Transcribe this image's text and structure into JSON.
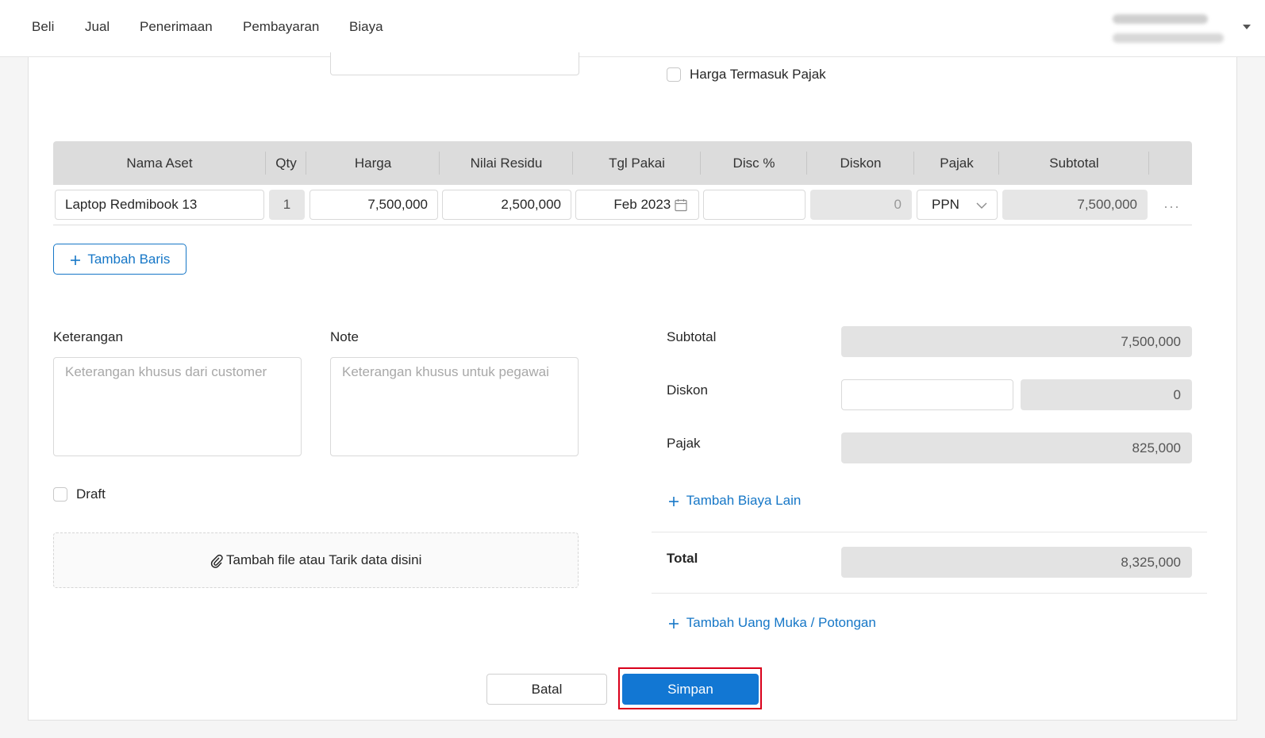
{
  "nav": {
    "items": [
      "Beli",
      "Jual",
      "Penerimaan",
      "Pembayaran",
      "Biaya"
    ]
  },
  "options": {
    "tax_included_label": "Harga Termasuk Pajak"
  },
  "table": {
    "headers": [
      "Nama Aset",
      "Qty",
      "Harga",
      "Nilai Residu",
      "Tgl Pakai",
      "Disc %",
      "Diskon",
      "Pajak",
      "Subtotal"
    ],
    "row": {
      "name": "Laptop Redmibook 13",
      "qty": "1",
      "price": "7,500,000",
      "residual": "2,500,000",
      "date": "Feb 2023",
      "disc_pct": "",
      "discount": "0",
      "tax": "PPN",
      "subtotal": "7,500,000",
      "more": "···"
    },
    "add_row_label": "Tambah Baris"
  },
  "notes": {
    "keterangan_label": "Keterangan",
    "keterangan_placeholder": "Keterangan khusus dari customer",
    "note_label": "Note",
    "note_placeholder": "Keterangan khusus untuk pegawai",
    "draft_label": "Draft",
    "attach_label": "Tambah file atau Tarik data disini"
  },
  "summary": {
    "subtotal_label": "Subtotal",
    "subtotal_value": "7,500,000",
    "diskon_label": "Diskon",
    "diskon_value": "0",
    "pajak_label": "Pajak",
    "pajak_value": "825,000",
    "add_cost_label": "Tambah Biaya Lain",
    "total_label": "Total",
    "total_value": "8,325,000",
    "add_down_payment_label": "Tambah Uang Muka / Potongan"
  },
  "actions": {
    "cancel_label": "Batal",
    "save_label": "Simpan"
  },
  "colors": {
    "accent": "#1277d3",
    "highlight": "#d9001b",
    "link": "#1677c7"
  }
}
